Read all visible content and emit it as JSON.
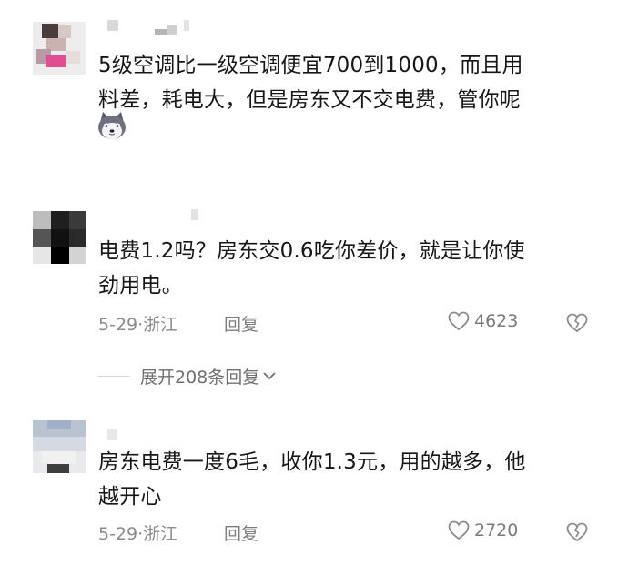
{
  "comments": [
    {
      "text_line1": "5级空调比一级空调便宜700到1000，而且用",
      "text_line2": "料差，耗电大，但是房东又不交电费，管你呢",
      "emoji": "husky-emoji-icon"
    },
    {
      "text_line1": "电费1.2吗？房东交0.6吃你差价，就是让你使",
      "text_line2": "劲用电。",
      "date": "5-29·浙江",
      "reply_label": "回复",
      "likes": "4623"
    },
    {
      "text_line1": "房东电费一度6毛，收你1.3元，用的越多，他",
      "text_line2": "越开心",
      "date": "5-29·浙江",
      "reply_label": "回复",
      "likes": "2720"
    }
  ],
  "expand_replies": {
    "label": "展开208条回复"
  },
  "colors": {
    "text": "#161616",
    "meta": "#8a8a8a",
    "icon": "#9a9a9a"
  }
}
